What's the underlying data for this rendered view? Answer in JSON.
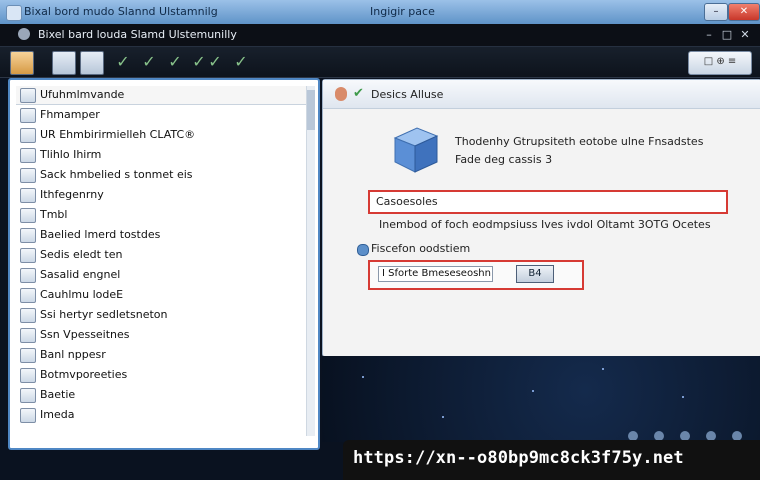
{
  "window": {
    "title_left": "Bixal bord mudo Slannd Ulstamnilg",
    "title_center": "Ingigir pace",
    "controls": [
      "–",
      "□",
      "✕"
    ]
  },
  "menubar": {
    "title": "Bixel bard louda Slamd Ulstemunilly",
    "right_buttons": [
      "–",
      "□",
      "✕"
    ]
  },
  "toolbar": {
    "buttons": [
      "folder",
      "user",
      "file",
      "check",
      "check",
      "check",
      "check",
      "check",
      "check",
      "check"
    ],
    "right_label": "□ ⊕ ≡"
  },
  "sidebar": {
    "items": [
      {
        "label": "Ufuhmlmvande",
        "icon": "check-icon"
      },
      {
        "label": "Fhmamper",
        "icon": "folder-icon"
      },
      {
        "label": "UR Ehmbirirmielleh CLATC®",
        "icon": "gear-icon"
      },
      {
        "label": "Tlihlo Ihirm",
        "icon": "document-icon"
      },
      {
        "label": "Sack hmbelied s tonmet eis",
        "icon": "shield-icon"
      },
      {
        "label": "Ithfegenrny",
        "icon": "monitor-icon"
      },
      {
        "label": "Tmbl",
        "icon": "settings-icon"
      },
      {
        "label": "Baelied lmerd tostdes",
        "icon": "calendar-icon"
      },
      {
        "label": "Sedis eledt ten",
        "icon": "network-icon"
      },
      {
        "label": "Sasalid engnel",
        "icon": "wifi-icon"
      },
      {
        "label": "Cauhlmu lodeE",
        "icon": "lock-icon"
      },
      {
        "label": "Ssi hertyr sedletsneton",
        "icon": "folder-icon"
      },
      {
        "label": "Ssn Vpesseitnes",
        "icon": "printer-icon"
      },
      {
        "label": "Banl nppesr",
        "icon": "drive-icon"
      },
      {
        "label": "Botmvporeeties",
        "icon": "globe-icon"
      },
      {
        "label": "Baetie",
        "icon": "star-icon"
      },
      {
        "label": "Imeda",
        "icon": "document-icon"
      }
    ]
  },
  "dialog": {
    "title": "Desics Alluse",
    "line1": "Thodenhy Gtrupsiteth eotobe ulne Fnsadstes",
    "line2": "Fade deg cassis 3",
    "field1_value": "Casoesoles",
    "line3": "Inembod of foch eodmpsiuss Ives ivdol Oltamt 3OTG Ocetes",
    "radio_label": "Fiscefon oodstiem",
    "field2_value": "I Sforte Bmeseseoshn",
    "field2_button": "B4"
  },
  "banner": {
    "url": "https://xn--o80bp9mc8ck3f75y.net"
  },
  "colors": {
    "accent_blue": "#4f87c4",
    "highlight_red": "#d63a34",
    "titlebar": "#5f93c8",
    "banner_bg": "#111111"
  }
}
